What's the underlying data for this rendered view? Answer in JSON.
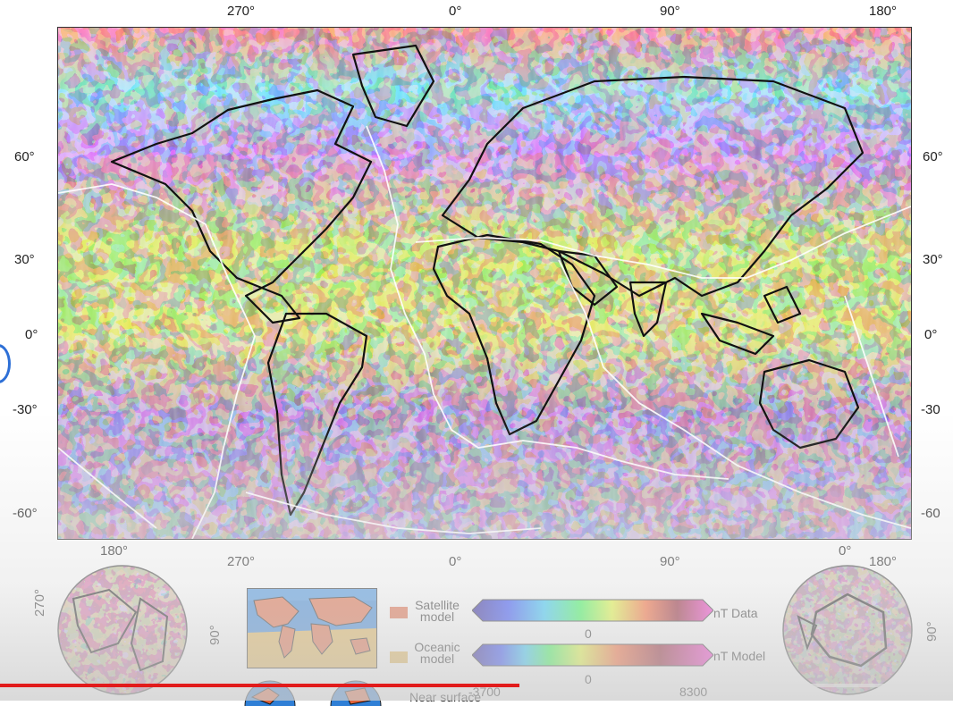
{
  "top_lon_labels": [
    "270°",
    "0°",
    "90°",
    "180°"
  ],
  "bottom_lon_labels": [
    "180°",
    "270°",
    "0°",
    "90°",
    "0°",
    "180°"
  ],
  "lat_labels_left": [
    "60°",
    "30°",
    "0°",
    "-30°",
    "-60°"
  ],
  "lat_labels_right": [
    "60°",
    "30°",
    "0°",
    "-30",
    "-60"
  ],
  "polar_left": {
    "left_label": "270°",
    "right_label": "90°"
  },
  "polar_right": {
    "right_label": "90°"
  },
  "legend": {
    "satellite_label": "Satellite\nmodel",
    "oceanic_label": "Oceanic\nmodel",
    "near_surface_label": "Near surface",
    "bar1_unit": "nT Data",
    "bar1_center": "0",
    "bar2_unit": "nT Model",
    "bar2_center": "0",
    "bar2_min": "-3700",
    "bar2_max": "8300"
  },
  "colors": {
    "satellite": "#e0623a",
    "oceanic": "#e2b24e",
    "progress": "#e21b1b"
  },
  "playback_progress": 0.545
}
